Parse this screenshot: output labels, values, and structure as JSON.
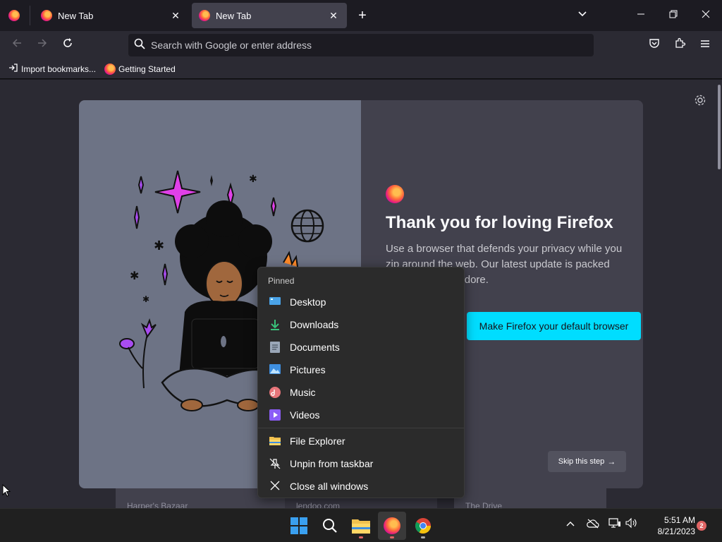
{
  "browser": {
    "tabs": [
      {
        "title": "New Tab",
        "active": false
      },
      {
        "title": "New Tab",
        "active": true
      }
    ],
    "new_tab_symbol": "+",
    "urlbar_placeholder": "Search with Google or enter address",
    "bookmarks": [
      {
        "label": "Import bookmarks...",
        "icon": "import-icon"
      },
      {
        "label": "Getting Started",
        "icon": "firefox-icon"
      }
    ]
  },
  "onboarding": {
    "title": "Thank you for loving Firefox",
    "subtitle_line1": "Use a browser that defends your privacy while you",
    "subtitle_line2": "zip around the web. Our latest update is packed",
    "subtitle_line3": "with things you adore.",
    "primary_button": "Make Firefox your default browser",
    "skip_button": "Skip this step"
  },
  "shortcuts": [
    {
      "label": "Harper's Bazaar"
    },
    {
      "label": "lendoo.com"
    },
    {
      "label": "The Drive"
    }
  ],
  "jumplist": {
    "header": "Pinned",
    "pinned": [
      {
        "label": "Desktop",
        "icon": "desktop-icon",
        "color": "#4aa3e8"
      },
      {
        "label": "Downloads",
        "icon": "download-icon",
        "color": "#39c27a"
      },
      {
        "label": "Documents",
        "icon": "document-icon",
        "color": "#9aa7b8"
      },
      {
        "label": "Pictures",
        "icon": "pictures-icon",
        "color": "#3f8fe0"
      },
      {
        "label": "Music",
        "icon": "music-icon",
        "color": "#e8757a"
      },
      {
        "label": "Videos",
        "icon": "videos-icon",
        "color": "#8b5cf6"
      }
    ],
    "actions": [
      {
        "label": "File Explorer",
        "icon": "file-explorer-icon"
      },
      {
        "label": "Unpin from taskbar",
        "icon": "unpin-icon"
      },
      {
        "label": "Close all windows",
        "icon": "close-icon"
      }
    ]
  },
  "taskbar": {
    "time": "5:51 AM",
    "date": "8/21/2023",
    "notification_count": "2"
  },
  "colors": {
    "accent": "#00ddff",
    "taskbar_bg": "#202020",
    "browser_bg": "#1c1b22"
  }
}
